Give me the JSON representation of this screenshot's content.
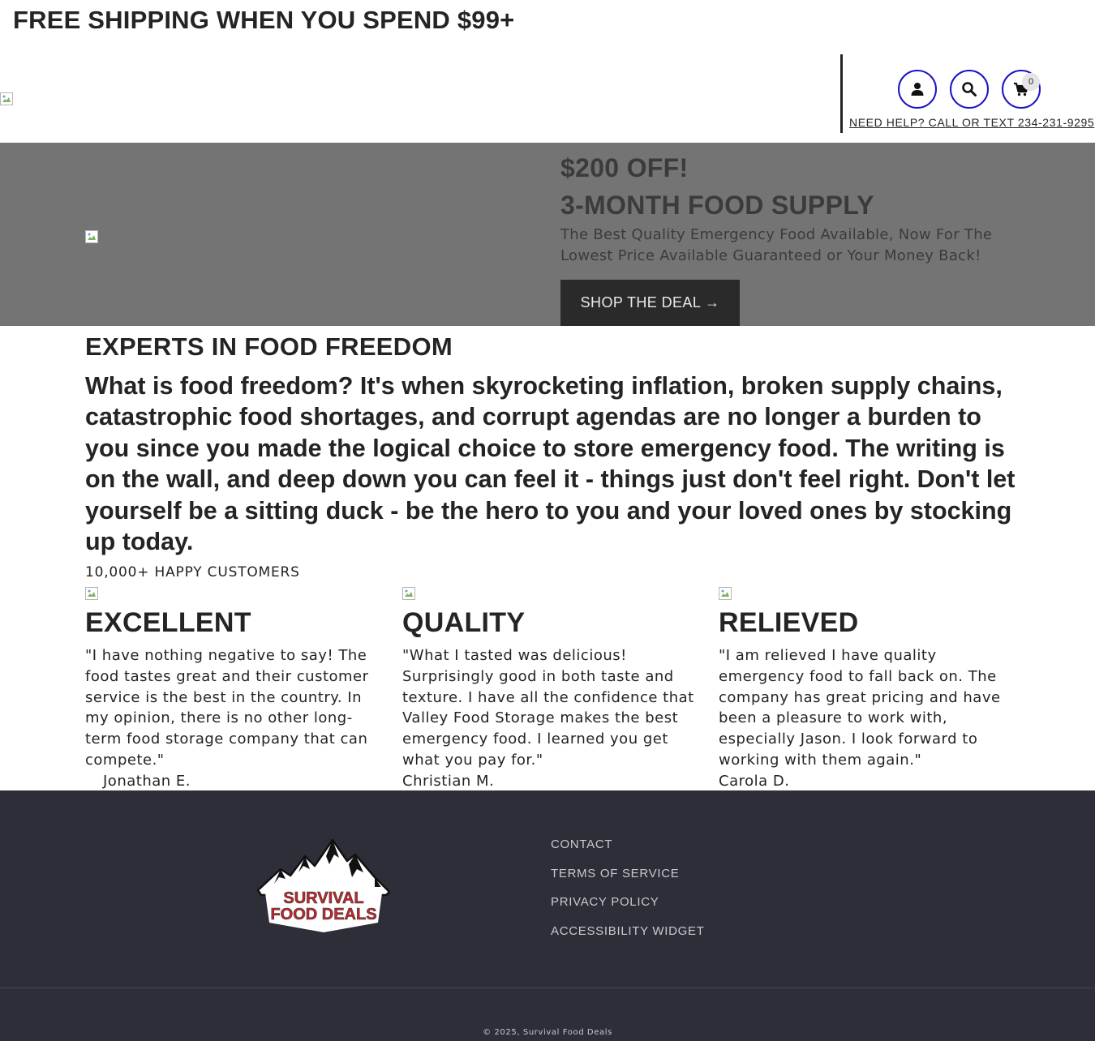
{
  "announcement": {
    "text": "FREE SHIPPING WHEN YOU SPEND $99+"
  },
  "header": {
    "logo_alt": "",
    "icons": {
      "account": "account-icon",
      "search": "search-icon",
      "cart": "cart-icon"
    },
    "cart_count": "0",
    "help_text": "NEED HELP? CALL OR TEXT 234-231-9295",
    "accent_color": "#1a13c9"
  },
  "hero": {
    "title_line1": "$200 OFF!",
    "title_line2": "3-MONTH FOOD SUPPLY",
    "text": "The Best Quality Emergency Food Available, Now For The Lowest Price Available Guaranteed or Your Money Back!",
    "button_label": "SHOP THE DEAL →",
    "background_color": "#747474"
  },
  "experts": {
    "heading": "EXPERTS IN FOOD FREEDOM",
    "body": "What is food freedom? It's when skyrocketing inflation, broken supply chains, catastrophic food shortages, and corrupt agendas are no longer a burden to you since you made the logical choice to store emergency food. The writing is on the wall, and deep down you can feel it - things just don't feel right. Don't let yourself be a sitting duck - be the hero to you and your loved ones by stocking up today.",
    "customers": "10,000+ HAPPY CUSTOMERS"
  },
  "testimonials": [
    {
      "title": "EXCELLENT",
      "quote": "\"I have nothing negative to say! The food tastes great and their customer service is the best in the country. In my opinion, there is no other long-term food storage company that can compete.\"",
      "author": "Jonathan E."
    },
    {
      "title": "QUALITY",
      "quote": "\"What I tasted was delicious! Surprisingly good in both taste and texture. I have all the confidence that Valley Food Storage makes the best emergency food. I learned you get what you pay for.\"",
      "author": "Christian M."
    },
    {
      "title": "RELIEVED",
      "quote": "\"I am relieved I have quality emergency food to fall back on. The company has great pricing and have been a pleasure to work with, especially Jason. I look forward to working with them again.\"",
      "author": "Carola D."
    }
  ],
  "footer": {
    "logo": {
      "line1": "SURVIVAL",
      "line2": "FOOD DEALS",
      "brand_color": "#c4242b"
    },
    "links": [
      "CONTACT",
      "TERMS OF SERVICE",
      "PRIVACY POLICY",
      "ACCESSIBILITY WIDGET"
    ],
    "copyright": "© 2025, Survival Food Deals",
    "background_color": "#2d2e38"
  }
}
